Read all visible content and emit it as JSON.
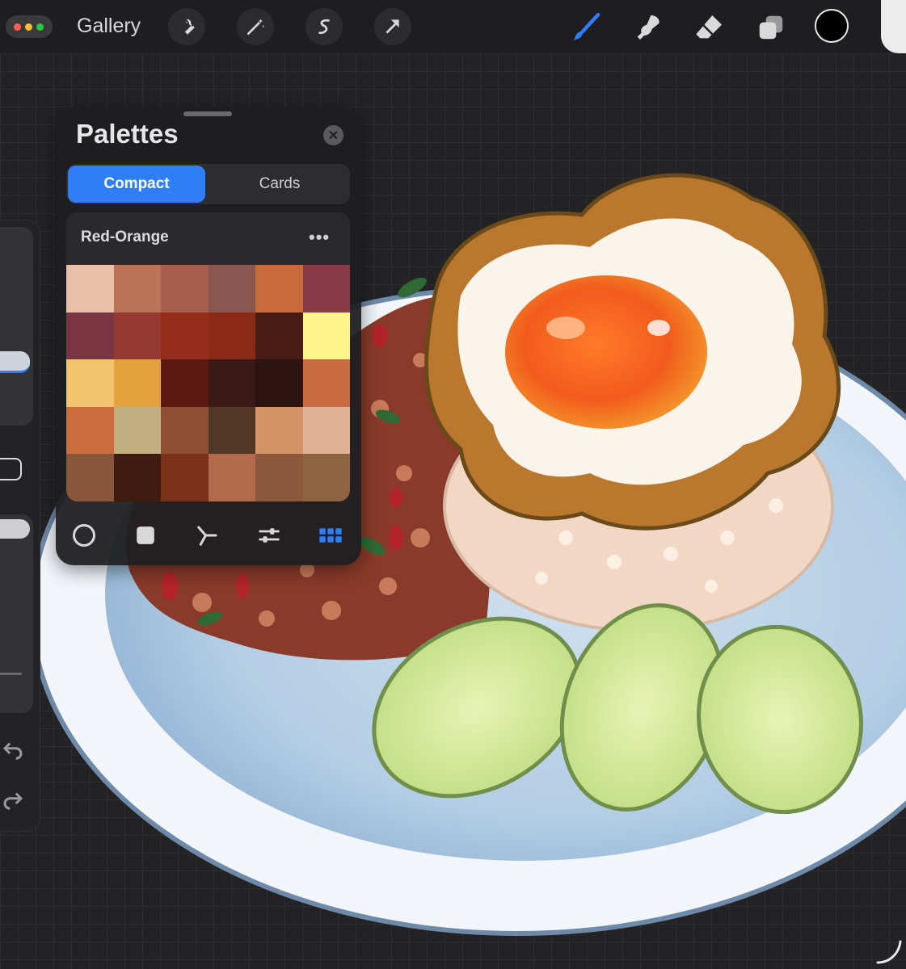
{
  "topbar": {
    "gallery_label": "Gallery",
    "left_tools": [
      "wrench-icon",
      "magic-wand-icon",
      "selection-icon",
      "transform-arrow-icon"
    ],
    "right_tools": [
      "brush-icon",
      "smudge-icon",
      "eraser-icon",
      "layers-icon"
    ],
    "current_color": "#000000",
    "brush_accent": "#2f7ef7"
  },
  "palettes_panel": {
    "title": "Palettes",
    "tabs": [
      {
        "label": "Compact",
        "active": true
      },
      {
        "label": "Cards",
        "active": false
      }
    ],
    "palette": {
      "name": "Red-Orange",
      "more_label": "•••",
      "swatches": [
        "#e8bfa8",
        "#b97356",
        "#a65f4f",
        "#8a5650",
        "#c76b3c",
        "#883a48",
        "#7a3542",
        "#953a33",
        "#962d1b",
        "#8c2a18",
        "#4a1c16",
        "#fdf58c",
        "#f2c46e",
        "#e4a13e",
        "#5a1a12",
        "#3a1a16",
        "#2e1410",
        "#c86b3e",
        "#cc6d3e",
        "#c1af7f",
        "#8e4f33",
        "#523726",
        "#d49468",
        "#e0b092",
        "#8a573a",
        "#3f1b10",
        "#7b301a",
        "#b26b4a",
        "#8c583c",
        "#8e6440"
      ]
    },
    "modes": [
      "disc-icon",
      "classic-square-icon",
      "harmony-icon",
      "value-sliders-icon",
      "palette-grid-icon"
    ],
    "active_mode": "palette-grid-icon"
  }
}
